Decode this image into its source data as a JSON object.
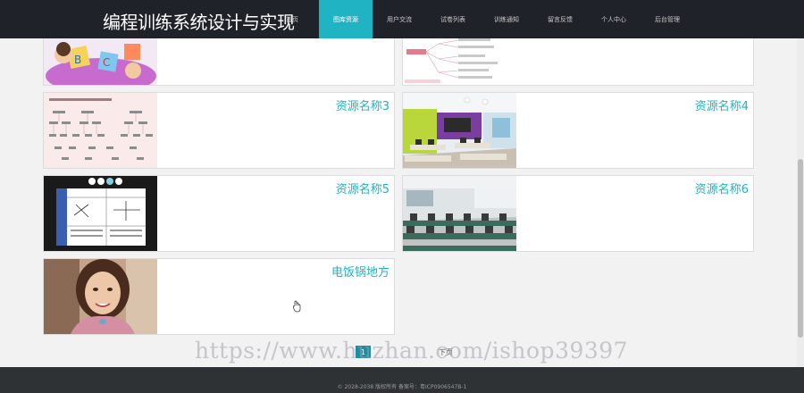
{
  "header": {
    "brand": "编程训练系统设计与实现",
    "nav": [
      {
        "label": "首页",
        "active": false
      },
      {
        "label": "图库资源",
        "active": true
      },
      {
        "label": "用户交流",
        "active": false
      },
      {
        "label": "试卷列表",
        "active": false
      },
      {
        "label": "训练通知",
        "active": false
      },
      {
        "label": "留言反馈",
        "active": false
      },
      {
        "label": "个人中心",
        "active": false
      },
      {
        "label": "后台管理",
        "active": false
      }
    ]
  },
  "cards": [
    {
      "title": "",
      "image": "cartoon-kids-image"
    },
    {
      "title": "",
      "image": "mindmap-image"
    },
    {
      "title": "资源名称3",
      "image": "flowchart-image"
    },
    {
      "title": "资源名称4",
      "image": "classroom-image"
    },
    {
      "title": "资源名称5",
      "image": "math-table-image"
    },
    {
      "title": "资源名称6",
      "image": "computer-lab-image"
    },
    {
      "title": "电饭锅地方",
      "image": "woman-portrait-image"
    }
  ],
  "pagination": {
    "current": "1",
    "next": "下页"
  },
  "footer": {
    "text": "© 2028-2038 版权所有 备案号：粤ICP0906547B-1"
  },
  "watermark": "https://www.huzhan.com/ishop39397",
  "colors": {
    "accent": "#1fb3c4",
    "topbar": "#1f2329",
    "footer": "#2f3235"
  }
}
